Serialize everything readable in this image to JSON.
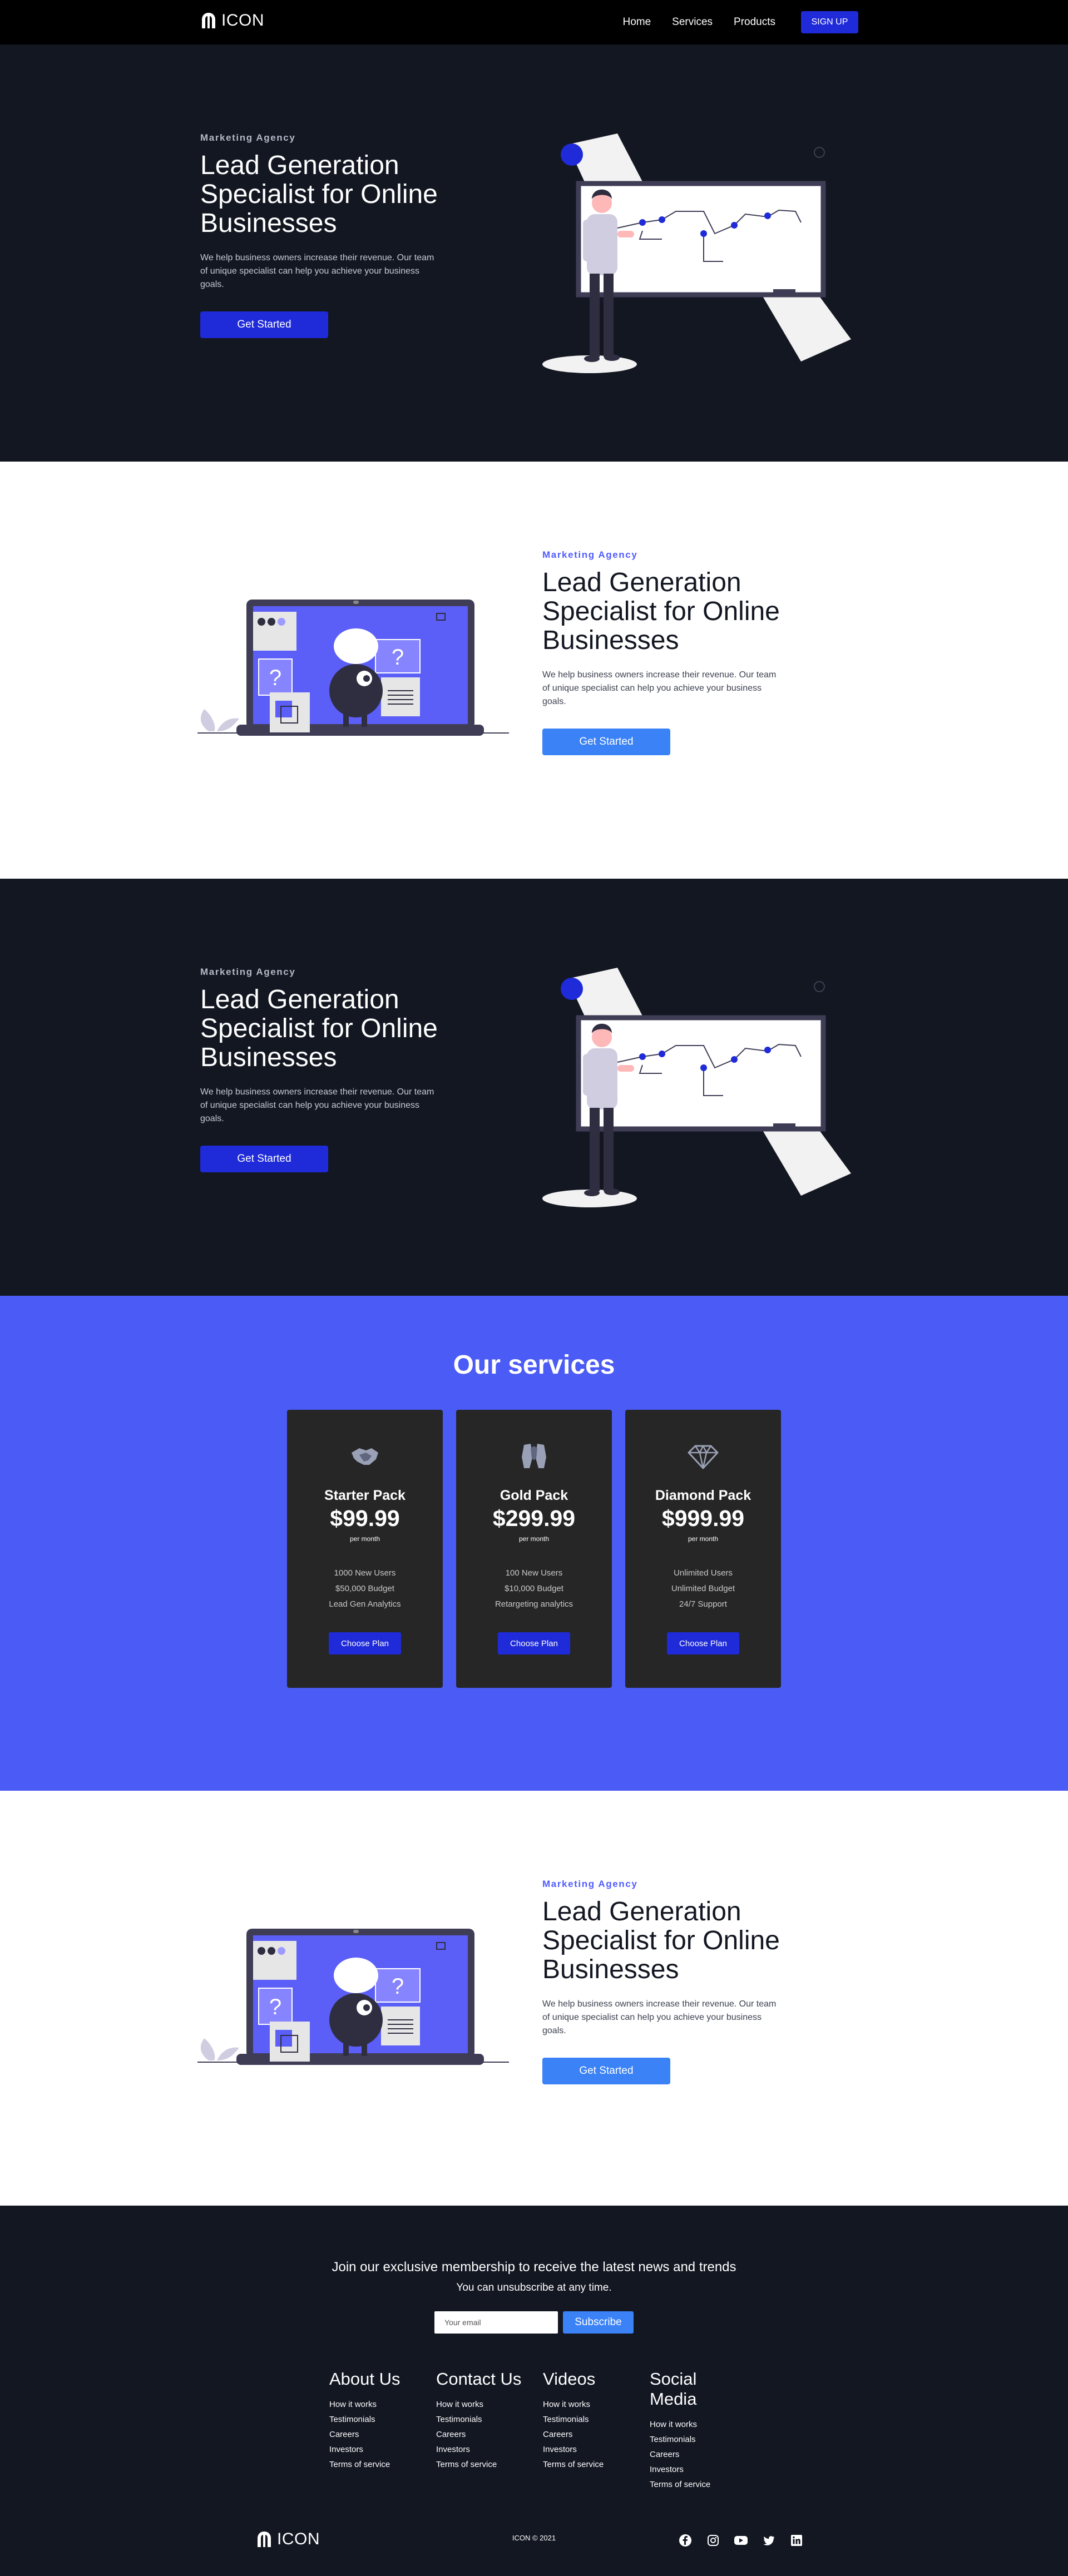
{
  "nav": {
    "logo_text": "ICON",
    "links": [
      "Home",
      "Services",
      "Products"
    ],
    "signup_label": "SIGN UP"
  },
  "hero": {
    "eyebrow": "Marketing Agency",
    "headline": "Lead Generation Specialist for Online Businesses",
    "description": "We help business owners increase their revenue. Our team of unique specialist can help you achieve your business goals.",
    "cta_label": "Get Started"
  },
  "services": {
    "title": "Our services",
    "cards": [
      {
        "icon": "handshake-icon",
        "name": "Starter Pack",
        "price": "$99.99",
        "period": "per month",
        "features": [
          "1000 New Users",
          "$50,000 Budget",
          "Lead Gen Analytics"
        ],
        "button": "Choose Plan"
      },
      {
        "icon": "handshake-hands-icon",
        "name": "Gold Pack",
        "price": "$299.99",
        "period": "per month",
        "features": [
          "100 New Users",
          "$10,000 Budget",
          "Retargeting analytics"
        ],
        "button": "Choose Plan"
      },
      {
        "icon": "diamond-icon",
        "name": "Diamond Pack",
        "price": "$999.99",
        "period": "per month",
        "features": [
          "Unlimited Users",
          "Unlimited Budget",
          "24/7 Support"
        ],
        "button": "Choose Plan"
      }
    ]
  },
  "footer": {
    "join_text": "Join our exclusive membership to receive the latest news and trends",
    "unsubscribe_text": "You can unsubscribe at any time.",
    "email_placeholder": "Your email",
    "subscribe_label": "Subscribe",
    "columns": [
      {
        "title": "About Us",
        "links": [
          "How it works",
          "Testimonials",
          "Careers",
          "Investors",
          "Terms of service"
        ]
      },
      {
        "title": "Contact Us",
        "links": [
          "How it works",
          "Testimonials",
          "Careers",
          "Investors",
          "Terms of service"
        ]
      },
      {
        "title": "Videos",
        "links": [
          "How it works",
          "Testimonials",
          "Careers",
          "Investors",
          "Terms of service"
        ]
      },
      {
        "title": "Social Media",
        "links": [
          "How it works",
          "Testimonials",
          "Careers",
          "Investors",
          "Terms of service"
        ]
      }
    ],
    "logo_text": "ICON",
    "copyright": "ICON © 2021",
    "social_icons": [
      "facebook-icon",
      "instagram-icon",
      "youtube-icon",
      "twitter-icon",
      "linkedin-icon"
    ]
  },
  "colors": {
    "dark_bg": "#131722",
    "accent_blue": "#1f2bd8",
    "services_bg": "#4b5bf5",
    "button_light": "#3b82f6",
    "card_bg": "#262626"
  }
}
